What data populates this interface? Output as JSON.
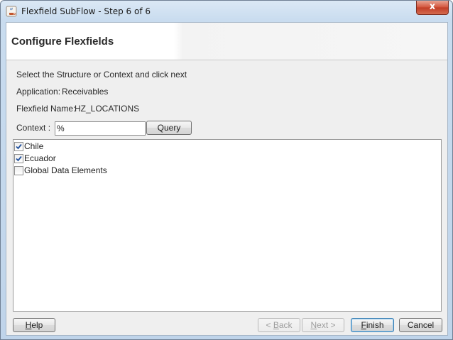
{
  "window": {
    "title": "Flexfield SubFlow - Step 6 of 6",
    "close_label": "x"
  },
  "banner": {
    "title": "Configure Flexfields"
  },
  "form": {
    "instruction": "Select the Structure or Context and click next",
    "application_label": "Application:",
    "application_value": "Receivables",
    "flexfield_label": "Flexfield Name:",
    "flexfield_value": "HZ_LOCATIONS",
    "context_label": "Context :",
    "context_value": "%",
    "query_button": "Query"
  },
  "list": {
    "items": [
      {
        "label": "Chile",
        "checked": true
      },
      {
        "label": "Ecuador",
        "checked": true
      },
      {
        "label": "Global Data Elements",
        "checked": false
      }
    ]
  },
  "footer": {
    "help": {
      "prefix": "",
      "mnemonic": "H",
      "suffix": "elp"
    },
    "back": {
      "prefix": "< ",
      "mnemonic": "B",
      "suffix": "ack"
    },
    "next": {
      "prefix": "",
      "mnemonic": "N",
      "suffix": "ext >"
    },
    "finish": {
      "prefix": "",
      "mnemonic": "F",
      "suffix": "inish"
    },
    "cancel": "Cancel"
  },
  "colors": {
    "title_gradient_top": "#dbe8f5",
    "close_red": "#c13d26",
    "check_blue": "#1f4f9c",
    "default_button_border": "#3c7fb1"
  },
  "icons": {
    "app": "java-cup-icon",
    "close": "close-icon",
    "checkmark": "checkmark-icon"
  }
}
